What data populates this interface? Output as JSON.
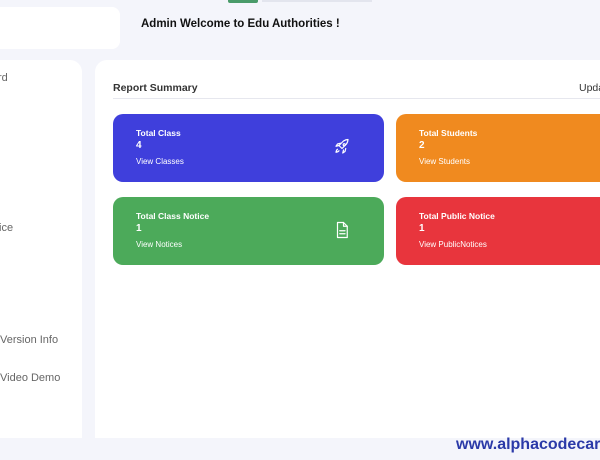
{
  "header": {
    "welcome": "Admin Welcome to Edu Authorities !"
  },
  "sidebar": {
    "items": [
      {
        "label": "rd"
      },
      {
        "label": "tice"
      },
      {
        "label": "Version Info"
      },
      {
        "label": "Video Demo"
      }
    ]
  },
  "report": {
    "title": "Report Summary",
    "update_label": "Upda"
  },
  "cards": [
    {
      "title": "Total Class",
      "value": "4",
      "link": "View Classes",
      "icon": "rocket-icon",
      "color": "#3f3fdc"
    },
    {
      "title": "Total Students",
      "value": "2",
      "link": "View Students",
      "color": "#f08a1f"
    },
    {
      "title": "Total Class Notice",
      "value": "1",
      "link": "View Notices",
      "icon": "file-icon",
      "color": "#4caa5a"
    },
    {
      "title": "Total Public Notice",
      "value": "1",
      "link": "View PublicNotices",
      "color": "#e8353d"
    }
  ],
  "watermark": "www.alphacodecar"
}
